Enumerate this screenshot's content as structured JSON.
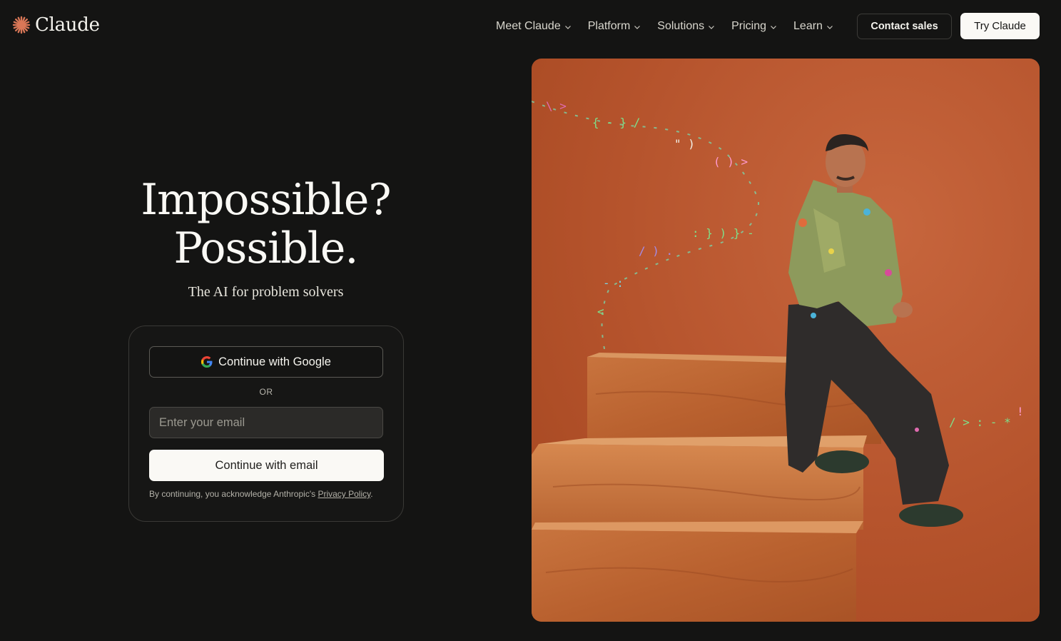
{
  "header": {
    "logo_icon": "claude-starburst-icon",
    "logo_text": "Claude",
    "brand_color": "#d97757",
    "nav": [
      {
        "label": "Meet Claude"
      },
      {
        "label": "Platform"
      },
      {
        "label": "Solutions"
      },
      {
        "label": "Pricing"
      },
      {
        "label": "Learn"
      }
    ],
    "contact_sales_label": "Contact sales",
    "try_claude_label": "Try Claude"
  },
  "hero": {
    "title_line1": "Impossible?",
    "title_line2": "Possible.",
    "subtitle": "The AI for problem solvers"
  },
  "login": {
    "google_icon": "google-g-icon",
    "google_button_label": "Continue with Google",
    "or_label": "OR",
    "email_placeholder": "Enter your email",
    "email_value": "",
    "email_button_label": "Continue with email",
    "disclaimer_prefix": "By continuing, you acknowledge Anthropic's ",
    "privacy_policy_label": "Privacy Policy",
    "disclaimer_suffix": "."
  },
  "colors": {
    "background": "#141413",
    "photo_background": "#b5532c",
    "primary_button": "#faf9f5"
  }
}
